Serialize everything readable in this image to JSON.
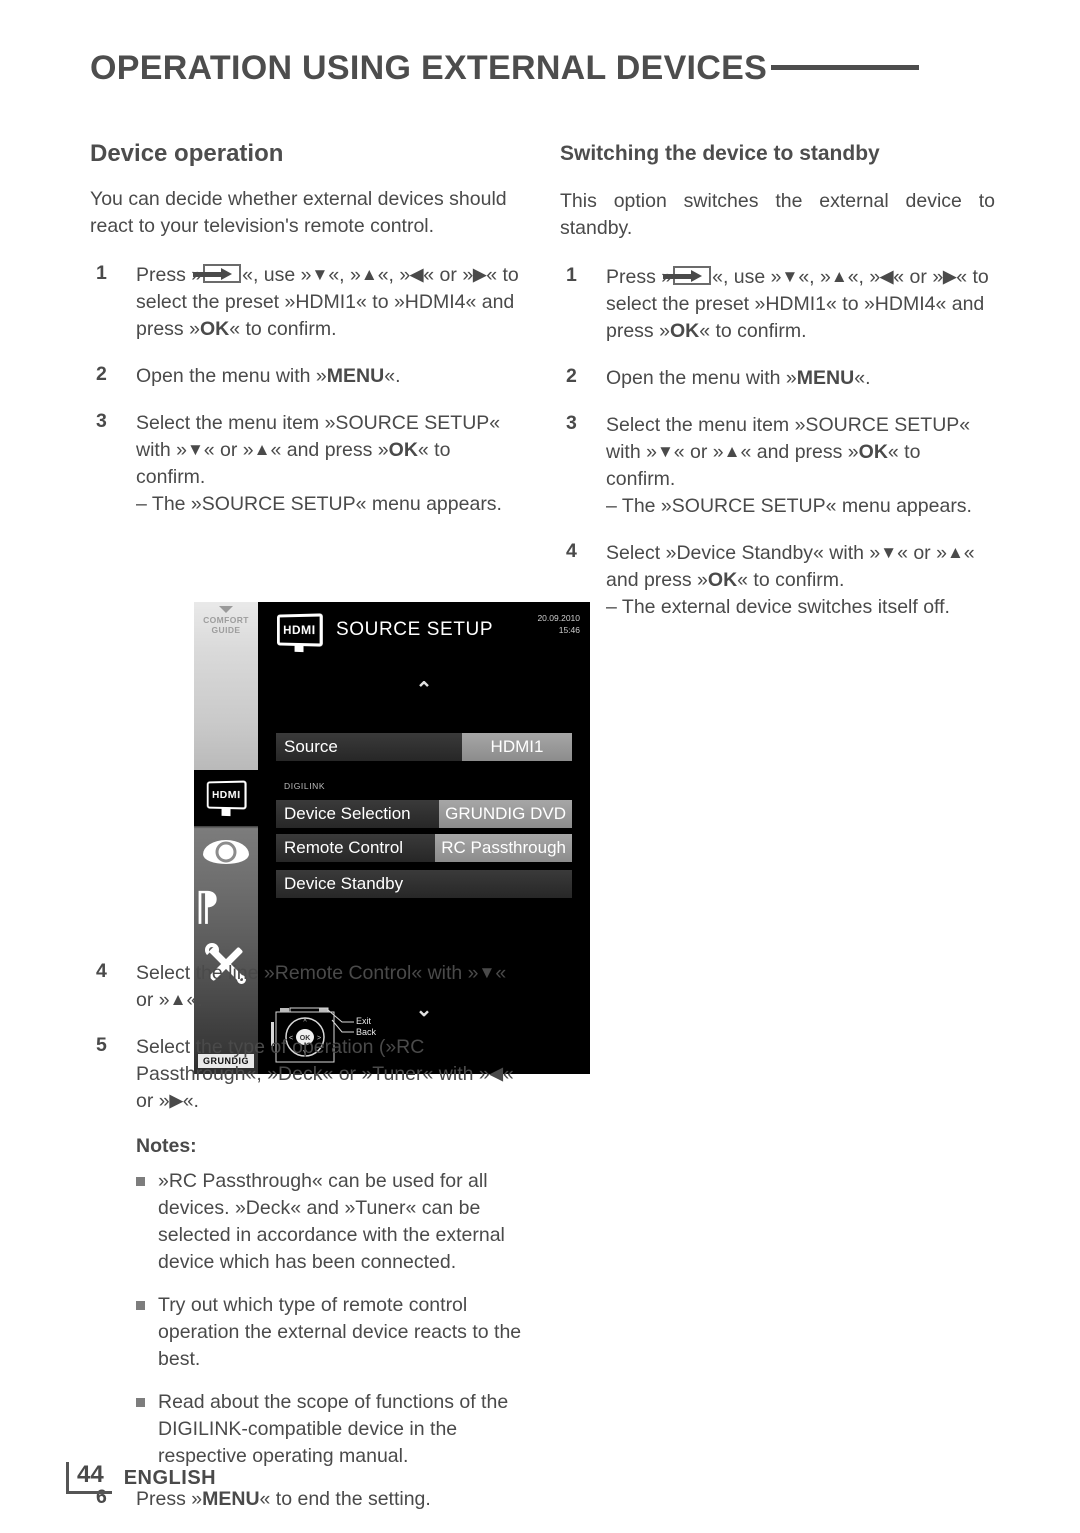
{
  "header": {
    "title": "OPERATION USING EXTERNAL DEVICES"
  },
  "left_column": {
    "section_title": "Device operation",
    "intro": "You can decide whether external devices should react to your television's remote control.",
    "steps": [
      {
        "num": "1",
        "text_a": "Press »",
        "icon": "source-input-button-icon",
        "text_b": "«, use »",
        "k1": "V",
        "text_c": "«, »",
        "k2": "A",
        "text_d": "«, »",
        "k3": "<",
        "text_e": "« or »",
        "k4": ">",
        "text_f": "« to select the preset »HDMI1« to »HDMI4« and press »",
        "k5": "OK",
        "text_g": "« to confirm."
      },
      {
        "num": "2",
        "text_a": "Open the menu with »",
        "k1": "MENU",
        "text_b": "«."
      },
      {
        "num": "3",
        "text_a": "Select the menu item »SOURCE SETUP« with »",
        "k1": "V",
        "text_b": "« or »",
        "k2": "A",
        "text_c": "« and press »",
        "k3": "OK",
        "text_d": "« to confirm.",
        "sub": "– The »SOURCE SETUP« menu appears."
      },
      {
        "num": "4",
        "text_a": "Select the line »Remote Control« with »",
        "k1": "V",
        "text_b": "« or »",
        "k2": "A",
        "text_c": "«."
      },
      {
        "num": "5",
        "text_a": "Select the type of operation (»RC Passthrough«, »Deck« or »Tuner« with »",
        "k1": "<",
        "text_b": "« or »",
        "k2": ">",
        "text_c": "«."
      }
    ],
    "notes_heading": "Notes:",
    "notes": [
      "»RC Passthrough« can be used for all devices. »Deck« and »Tuner« can be selected in accordance with the external device which has been connected.",
      "Try out which type of remote control operation the external device reacts to the best.",
      "Read about the scope of functions of the DIGILINK-compatible device in the respective operating manual."
    ],
    "final_step": {
      "num": "6",
      "text_a": "Press »",
      "k1": "MENU",
      "text_b": "« to end the setting."
    }
  },
  "right_column": {
    "section_title": "Switching the device to standby",
    "intro": "This option switches the external device to standby.",
    "steps": [
      {
        "num": "1",
        "text_a": "Press »",
        "icon": "source-input-button-icon",
        "text_b": "«, use »",
        "k1": "V",
        "text_c": "«, »",
        "k2": "A",
        "text_d": "«, »",
        "k3": "<",
        "text_e": "« or »",
        "k4": ">",
        "text_f": "« to select the preset »HDMI1« to »HDMI4« and press »",
        "k5": "OK",
        "text_g": "« to confirm."
      },
      {
        "num": "2",
        "text_a": "Open the menu with »",
        "k1": "MENU",
        "text_b": "«."
      },
      {
        "num": "3",
        "text_a": "Select the menu item »SOURCE SETUP« with »",
        "k1": "V",
        "text_b": "« or »",
        "k2": "A",
        "text_c": "« and press »",
        "k3": "OK",
        "text_d": "« to confirm.",
        "sub": "– The »SOURCE SETUP« menu appears."
      },
      {
        "num": "4",
        "text_a": "Select »Device Standby« with »",
        "k1": "V",
        "text_b": "« or »",
        "k2": "A",
        "text_c": "« and press »",
        "k3": "OK",
        "text_d": "« to confirm.",
        "sub": "– The external device switches itself off."
      }
    ]
  },
  "tv_screenshot": {
    "sidebar": {
      "top_label_line1": "COMFORT",
      "top_label_line2": "GUIDE",
      "hdmi_label": "HDMI",
      "brand": "GRUNDIG",
      "icons": [
        "hdmi-icon",
        "eye-icon",
        "ear-icon",
        "tools-icon"
      ]
    },
    "title": "SOURCE SETUP",
    "title_badge": "HDMI",
    "date": "20.09.2010",
    "time": "15:46",
    "group_label": "DIGILINK",
    "rows": [
      {
        "label": "Source",
        "value": "HDMI1"
      },
      {
        "label": "Device Selection",
        "value": "GRUNDIG DVD"
      },
      {
        "label": "Remote Control",
        "value": "RC Passthrough"
      },
      {
        "label": "Device Standby",
        "value": ""
      }
    ],
    "remote_labels": {
      "exit": "Exit",
      "back": "Back",
      "ok": "OK"
    }
  },
  "footer": {
    "page_number": "44",
    "language": "ENGLISH"
  },
  "colors": {
    "text": "#4a4a4a",
    "osd_highlight": "#9a9a9a",
    "osd_row": "#303030"
  }
}
